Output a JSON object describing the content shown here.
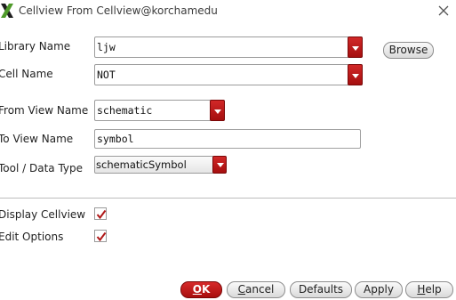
{
  "window": {
    "title": "Cellview From Cellview@korchamedu",
    "icon": "x-logo-icon",
    "close_icon": "close-icon"
  },
  "form": {
    "library_name": {
      "label": "Library Name",
      "value": "ljw"
    },
    "cell_name": {
      "label": "Cell Name",
      "value": "NOT"
    },
    "from_view_name": {
      "label": "From View Name",
      "value": "schematic"
    },
    "to_view_name": {
      "label": "To View Name",
      "value": "symbol"
    },
    "tool_data_type": {
      "label": "Tool / Data Type",
      "value": "schematicSymbol"
    },
    "browse_label": "Browse"
  },
  "options": {
    "display_cellview": {
      "label": "Display Cellview",
      "checked": true
    },
    "edit_options": {
      "label": "Edit Options",
      "checked": true
    }
  },
  "buttons": {
    "ok": {
      "first": "O",
      "rest": "K"
    },
    "cancel": {
      "first": "C",
      "rest": "ancel"
    },
    "defaults": "Defaults",
    "apply": "Apply",
    "help": {
      "first": "H",
      "rest": "elp"
    }
  },
  "colors": {
    "accent_red": "#b81a1a",
    "check_mark": "#b01818"
  }
}
